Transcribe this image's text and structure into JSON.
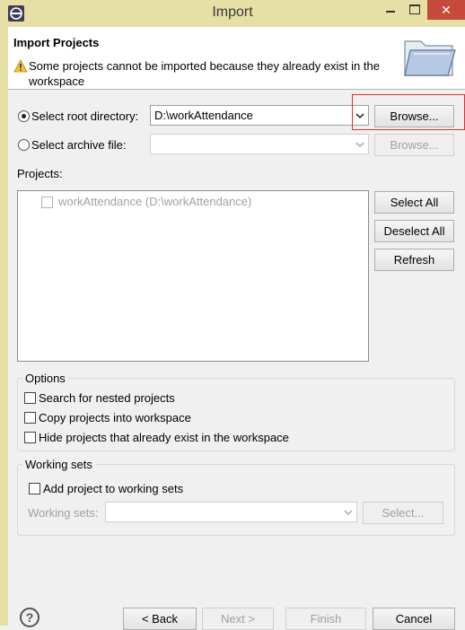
{
  "window": {
    "title": "Import",
    "close_glyph": "✕"
  },
  "header": {
    "title": "Import Projects",
    "warning": "Some projects cannot be imported because they already exist in the workspace"
  },
  "source": {
    "root_dir_label": "Select root directory:",
    "root_dir_value": "D:\\workAttendance",
    "root_dir_selected": true,
    "archive_label": "Select archive file:",
    "archive_value": "",
    "browse_label": "Browse..."
  },
  "projects": {
    "label": "Projects:",
    "items": [
      {
        "name": "workAttendance (D:\\workAttendance)",
        "checked": false,
        "enabled": false
      }
    ],
    "select_all": "Select All",
    "deselect_all": "Deselect All",
    "refresh": "Refresh"
  },
  "options": {
    "title": "Options",
    "items": [
      {
        "label": "Search for nested projects",
        "checked": false
      },
      {
        "label": "Copy projects into workspace",
        "checked": false
      },
      {
        "label": "Hide projects that already exist in the workspace",
        "checked": false
      }
    ]
  },
  "working_sets": {
    "title": "Working sets",
    "add_label": "Add project to working sets",
    "field_label": "Working sets:",
    "select_label": "Select..."
  },
  "footer": {
    "help_glyph": "?",
    "back": "< Back",
    "next": "Next >",
    "finish": "Finish",
    "cancel": "Cancel"
  },
  "icons": {
    "app": "eclipse-icon",
    "warning": "warning-icon",
    "folder": "folder-icon",
    "help": "help-icon"
  },
  "colors": {
    "title_bar": "#e6dfa6",
    "close_button": "#c7493a",
    "highlight": "#e03030"
  }
}
